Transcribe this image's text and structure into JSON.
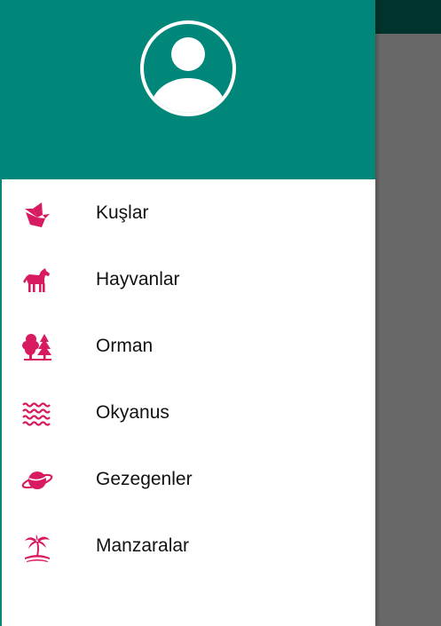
{
  "colors": {
    "header": "#00877a",
    "topbar": "#00332b",
    "scrim": "#686868",
    "icon_accent": "#d81b60",
    "text": "#111111"
  },
  "header": {
    "avatar_icon": "account-circle-icon"
  },
  "nav": {
    "items": [
      {
        "label": "Kuşlar",
        "icon": "bird-icon"
      },
      {
        "label": "Hayvanlar",
        "icon": "horse-icon"
      },
      {
        "label": "Orman",
        "icon": "forest-icon"
      },
      {
        "label": "Okyanus",
        "icon": "waves-icon"
      },
      {
        "label": "Gezegenler",
        "icon": "planet-icon"
      },
      {
        "label": "Manzaralar",
        "icon": "palm-tree-icon"
      }
    ]
  }
}
